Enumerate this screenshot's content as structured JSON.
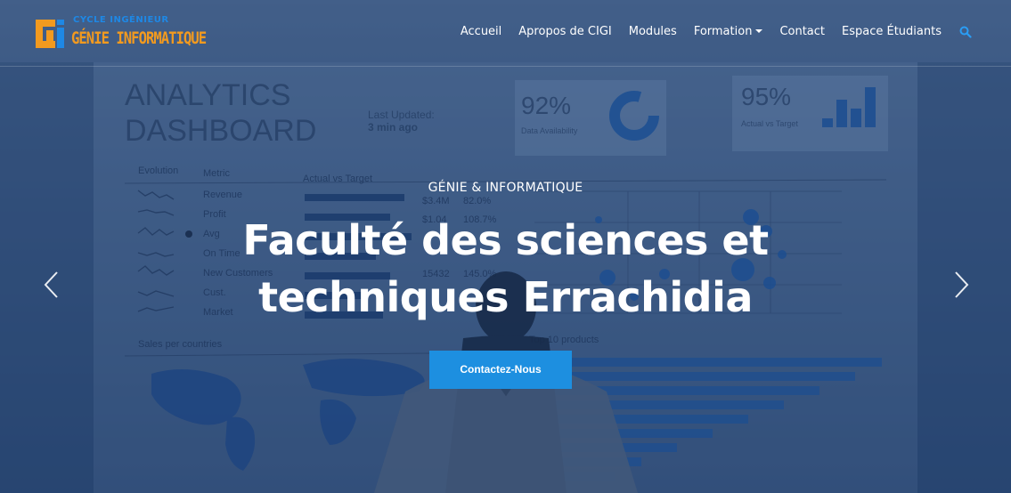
{
  "header": {
    "logo_top": "CYCLE INGÉNIEUR",
    "logo_main": "GÉNIE INFORMATIQUE",
    "nav": [
      {
        "label": "Accueil"
      },
      {
        "label": "Apropos de CIGI"
      },
      {
        "label": "Modules"
      },
      {
        "label": "Formation",
        "dropdown": true
      },
      {
        "label": "Contact"
      },
      {
        "label": "Espace Étudiants"
      }
    ],
    "search_icon": "search-icon"
  },
  "background": {
    "dashboard_title_1": "ANALYTICS",
    "dashboard_title_2": "DASHBOARD",
    "last_updated_label": "Last Updated:",
    "last_updated_value": "3 min ago",
    "kpi1_value": "92%",
    "kpi1_label": "Data Availability",
    "kpi2_value": "95%",
    "kpi2_label": "Actual vs Target",
    "col_evolution": "Evolution",
    "col_metric": "Metric",
    "col_actual_target": "Actual vs Target",
    "metrics": [
      "Revenue",
      "Profit",
      "Avg",
      "On Time",
      "New Customers",
      "Cust.",
      "Market"
    ],
    "values": [
      "$3.4M",
      "82.0%",
      "$1.04",
      "108.7%",
      "15432",
      "145.0%"
    ],
    "sales_label": "Sales per countries",
    "top_products_label": "Top 10 products"
  },
  "hero": {
    "subtitle": "GÉNIE & INFORMATIQUE",
    "title": "Faculté des sciences et techniques Errachidia",
    "cta_label": "Contactez-Nous"
  },
  "colors": {
    "accent": "#1d8fe0",
    "logo_orange": "#f29a1f",
    "logo_blue": "#1e88e5"
  }
}
